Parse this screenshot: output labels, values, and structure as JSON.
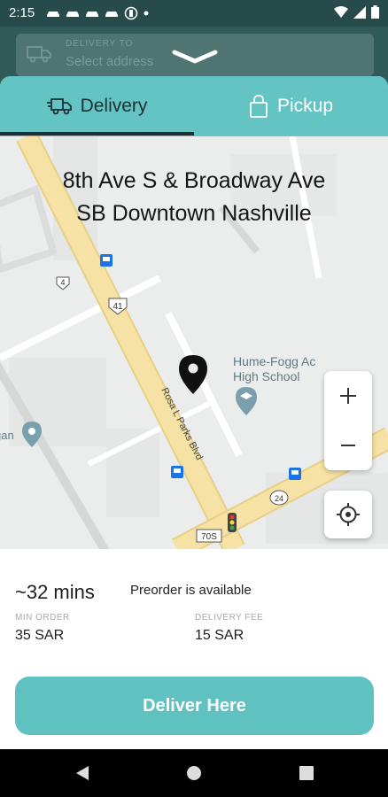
{
  "status_bar": {
    "time": "2:15",
    "icons_left": [
      "car-icon",
      "car-icon",
      "car-icon",
      "car-icon",
      "circle-icon",
      "dot-icon"
    ],
    "icons_right": [
      "wifi-icon",
      "signal-icon",
      "battery-icon"
    ]
  },
  "address_bar": {
    "caption": "DELIVERY TO",
    "placeholder": "Select address",
    "icon": "truck-icon"
  },
  "tabs": [
    {
      "label": "Delivery",
      "icon": "truck-icon",
      "selected": true
    },
    {
      "label": "Pickup",
      "icon": "bag-icon",
      "selected": false
    }
  ],
  "map": {
    "title_line1": "8th Ave S & Broadway Ave",
    "title_line2": "SB Downtown Nashville",
    "labels": {
      "school": "Hume-Fogg Ac",
      "school_line2": "High School",
      "street": "Rosa L Parks Blvd",
      "shield_41": "41",
      "shield_24": "24",
      "shield_70s": "70S",
      "shield_4x": "4",
      "edge_left": "gan"
    }
  },
  "info": {
    "eta": "~32 mins",
    "preorder": "Preorder is available",
    "min_order_label": "MIN ORDER",
    "min_order_value": "35 SAR",
    "delivery_fee_label": "DELIVERY FEE",
    "delivery_fee_value": "15 SAR",
    "cta": "Deliver Here"
  },
  "colors": {
    "accent": "#63c4c3",
    "button": "#5fc1c0",
    "tab_text_active": "#1d2e36",
    "road_major": "#f4dfa0"
  }
}
